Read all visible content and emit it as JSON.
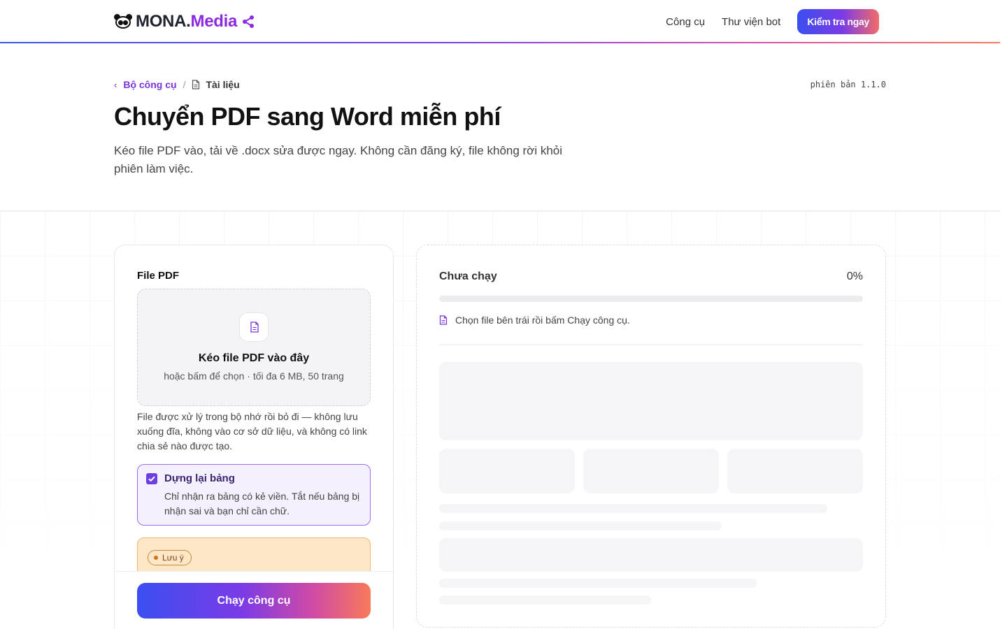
{
  "header": {
    "logo_part1": "MONA.",
    "logo_part2": "Media",
    "nav": [
      "Công cụ",
      "Thư viện bot"
    ],
    "cta_label": "Kiểm tra ngay",
    "accent_gradient": [
      "#3b4ff0",
      "#7a3be6",
      "#f26d6a"
    ]
  },
  "breadcrumb": {
    "back_label": "Bộ công cụ",
    "separator": "/",
    "current": "Tài liệu"
  },
  "version": "phiên bản 1.1.0",
  "hero": {
    "title": "Chuyển PDF sang Word miễn phí",
    "subtitle": "Kéo file PDF vào, tải về .docx sửa được ngay. Không cần đăng ký, file không rời khỏi phiên làm việc."
  },
  "upload": {
    "field_label": "File PDF",
    "dropzone_title": "Kéo file PDF vào đây",
    "dropzone_hint": "hoặc bấm để chọn · tối đa 6 MB, 50 trang",
    "privacy_note": "File được xử lý trong bộ nhớ rồi bỏ đi — không lưu xuống đĩa, không vào cơ sở dữ liệu, và không có link chia sẻ nào được tạo."
  },
  "option": {
    "checked": true,
    "title": "Dựng lại bảng",
    "description": "Chỉ nhận ra bảng có kẻ viền. Tắt nếu bảng bị nhận sai và bạn chỉ cần chữ."
  },
  "notice": {
    "badge": "Lưu ý"
  },
  "run_button_label": "Chạy công cụ",
  "result": {
    "status": "Chưa chạy",
    "percent_label": "0%",
    "progress": 0,
    "hint": "Chọn file bên trái rồi bấm Chạy công cụ."
  }
}
